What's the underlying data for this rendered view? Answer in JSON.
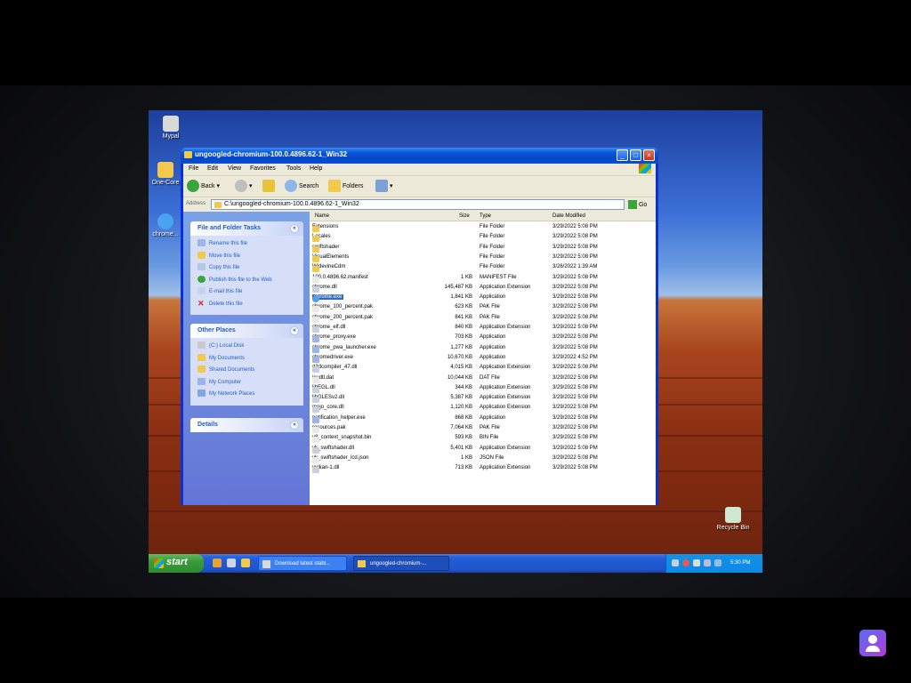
{
  "window": {
    "title": "ungoogled-chromium-100.0.4896.62-1_Win32",
    "menus": [
      "File",
      "Edit",
      "View",
      "Favorites",
      "Tools",
      "Help"
    ],
    "toolbar": {
      "back": "Back",
      "search": "Search",
      "folders": "Folders"
    },
    "address": {
      "label": "Address",
      "path": "C:\\ungoogled-chromium-100.0.4896.62-1_Win32",
      "go": "Go"
    }
  },
  "left_pane": {
    "tasks": {
      "title": "File and Folder Tasks",
      "items": [
        "Rename this file",
        "Move this file",
        "Copy this file",
        "Publish this file to the Web",
        "E-mail this file",
        "Delete this file"
      ]
    },
    "places": {
      "title": "Other Places",
      "items": [
        "(C:) Local Disk",
        "My Documents",
        "Shared Documents",
        "My Computer",
        "My Network Places"
      ]
    },
    "details": {
      "title": "Details"
    }
  },
  "file_list": {
    "columns": {
      "name": "Name",
      "size": "Size",
      "type": "Type",
      "date": "Date Modified"
    },
    "selected_index": 7,
    "rows": [
      {
        "name": "Extensions",
        "size": "",
        "type": "File Folder",
        "date": "3/29/2022 5:08 PM",
        "icon": "folder"
      },
      {
        "name": "Locales",
        "size": "",
        "type": "File Folder",
        "date": "3/29/2022 5:08 PM",
        "icon": "folder"
      },
      {
        "name": "swiftshader",
        "size": "",
        "type": "File Folder",
        "date": "3/29/2022 5:08 PM",
        "icon": "folder"
      },
      {
        "name": "VisualElements",
        "size": "",
        "type": "File Folder",
        "date": "3/29/2022 5:08 PM",
        "icon": "folder"
      },
      {
        "name": "WidevineCdm",
        "size": "",
        "type": "File Folder",
        "date": "3/26/2022 1:39 AM",
        "icon": "folder"
      },
      {
        "name": "100.0.4896.62.manifest",
        "size": "1 KB",
        "type": "MANIFEST File",
        "date": "3/29/2022 5:08 PM",
        "icon": "file"
      },
      {
        "name": "chrome.dll",
        "size": "145,487 KB",
        "type": "Application Extension",
        "date": "3/29/2022 5:08 PM",
        "icon": "dll"
      },
      {
        "name": "chrome.exe",
        "size": "1,841 KB",
        "type": "Application",
        "date": "3/29/2022 5:08 PM",
        "icon": "chrome"
      },
      {
        "name": "chrome_100_percent.pak",
        "size": "623 KB",
        "type": "PAK File",
        "date": "3/29/2022 5:08 PM",
        "icon": "file"
      },
      {
        "name": "chrome_200_percent.pak",
        "size": "841 KB",
        "type": "PAK File",
        "date": "3/29/2022 5:08 PM",
        "icon": "file"
      },
      {
        "name": "chrome_elf.dll",
        "size": "840 KB",
        "type": "Application Extension",
        "date": "3/29/2022 5:08 PM",
        "icon": "dll"
      },
      {
        "name": "chrome_proxy.exe",
        "size": "703 KB",
        "type": "Application",
        "date": "3/29/2022 5:08 PM",
        "icon": "exe"
      },
      {
        "name": "chrome_pwa_launcher.exe",
        "size": "1,277 KB",
        "type": "Application",
        "date": "3/29/2022 5:08 PM",
        "icon": "exe"
      },
      {
        "name": "chromedriver.exe",
        "size": "10,670 KB",
        "type": "Application",
        "date": "3/29/2022 4:52 PM",
        "icon": "exe"
      },
      {
        "name": "d3dcompiler_47.dll",
        "size": "4,015 KB",
        "type": "Application Extension",
        "date": "3/29/2022 5:08 PM",
        "icon": "dll"
      },
      {
        "name": "icudtl.dat",
        "size": "10,044 KB",
        "type": "DAT File",
        "date": "3/29/2022 5:08 PM",
        "icon": "file"
      },
      {
        "name": "libEGL.dll",
        "size": "344 KB",
        "type": "Application Extension",
        "date": "3/29/2022 5:08 PM",
        "icon": "dll"
      },
      {
        "name": "libGLESv2.dll",
        "size": "5,387 KB",
        "type": "Application Extension",
        "date": "3/29/2022 5:08 PM",
        "icon": "dll"
      },
      {
        "name": "mojo_core.dll",
        "size": "1,120 KB",
        "type": "Application Extension",
        "date": "3/29/2022 5:08 PM",
        "icon": "dll"
      },
      {
        "name": "notification_helper.exe",
        "size": "868 KB",
        "type": "Application",
        "date": "3/29/2022 5:08 PM",
        "icon": "exe"
      },
      {
        "name": "resources.pak",
        "size": "7,064 KB",
        "type": "PAK File",
        "date": "3/29/2022 5:08 PM",
        "icon": "file"
      },
      {
        "name": "v8_context_snapshot.bin",
        "size": "593 KB",
        "type": "BIN File",
        "date": "3/29/2022 5:08 PM",
        "icon": "file"
      },
      {
        "name": "vk_swiftshader.dll",
        "size": "5,401 KB",
        "type": "Application Extension",
        "date": "3/29/2022 5:08 PM",
        "icon": "dll"
      },
      {
        "name": "vk_swiftshader_icd.json",
        "size": "1 KB",
        "type": "JSON File",
        "date": "3/29/2022 5:08 PM",
        "icon": "file"
      },
      {
        "name": "vulkan-1.dll",
        "size": "713 KB",
        "type": "Application Extension",
        "date": "3/29/2022 5:08 PM",
        "icon": "dll"
      }
    ]
  },
  "desktop": {
    "icons": [
      {
        "label": "Mypal"
      },
      {
        "label": "One-Core"
      },
      {
        "label": "chrome..."
      },
      {
        "label": "Recycle Bin"
      }
    ]
  },
  "taskbar": {
    "start": "start",
    "tasks": [
      "Download latest stabl...",
      "ungoogled-chromium-..."
    ],
    "clock": "5:30 PM"
  },
  "colors": {
    "titlebar": "#0a58d8",
    "selection": "#316ac5",
    "folder": "#f2c94c",
    "start": "#3a9b3a"
  }
}
